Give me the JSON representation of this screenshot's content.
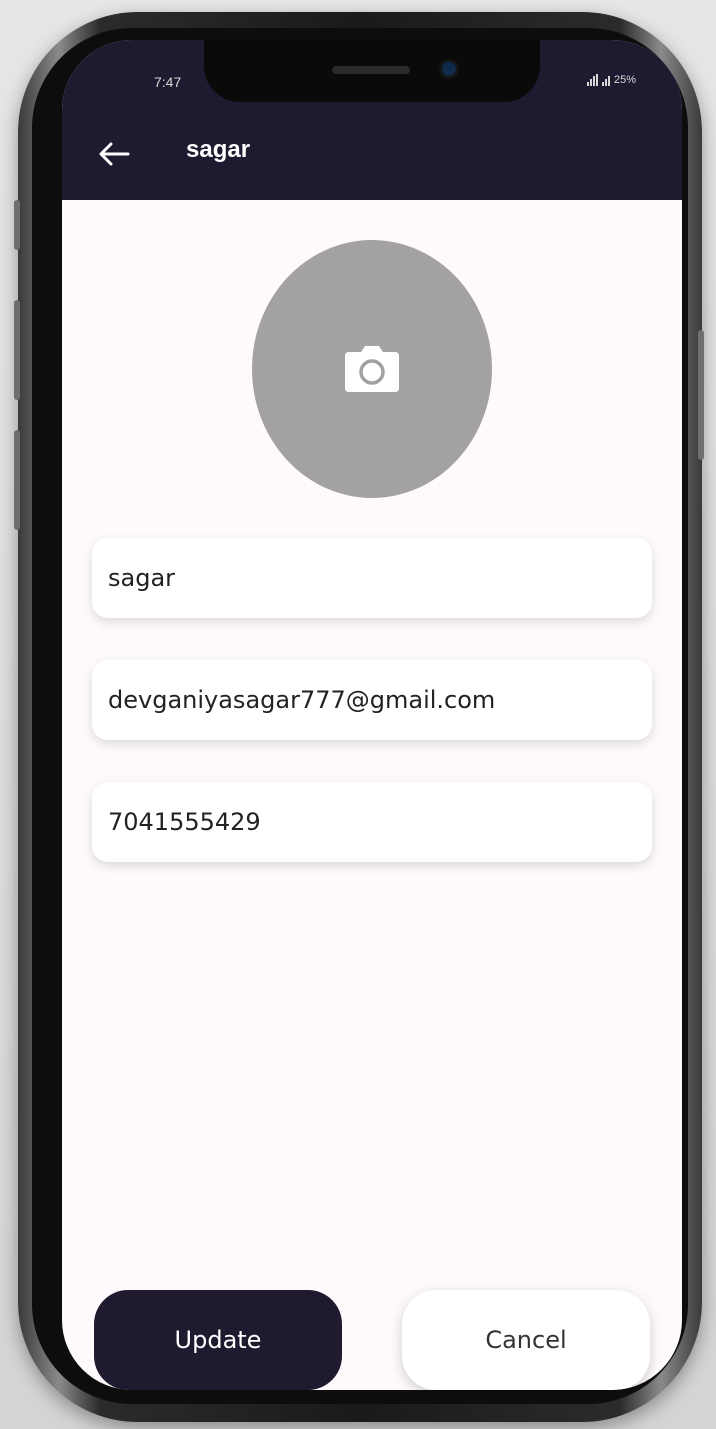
{
  "status_bar": {
    "time": "7:47",
    "battery": "25%"
  },
  "app_bar": {
    "title": "sagar",
    "back_icon": "arrow-left-icon"
  },
  "avatar": {
    "icon": "camera-icon",
    "color": "#a3a1a3"
  },
  "form": {
    "name_value": "sagar",
    "email_value": "devganiyasagar777@gmail.com",
    "phone_value": "7041555429"
  },
  "actions": {
    "update_label": "Update",
    "cancel_label": "Cancel"
  },
  "colors": {
    "app_bar": "#1f1a30",
    "screen_bg": "#fdf9fc",
    "update_button": "#1f1a30"
  }
}
